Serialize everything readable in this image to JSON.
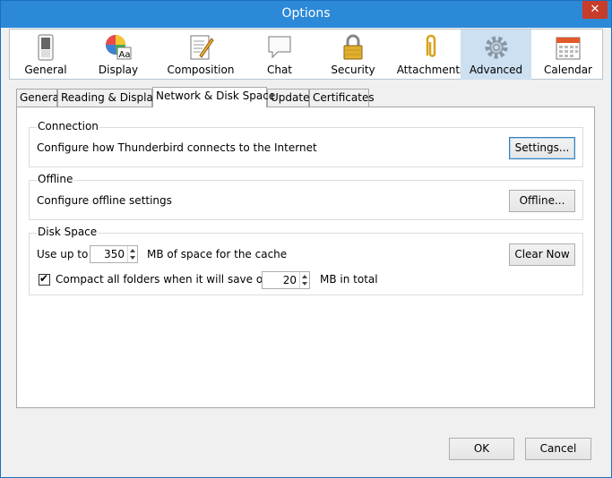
{
  "window": {
    "title": "Options",
    "close": "✕"
  },
  "categories": [
    {
      "label": "General"
    },
    {
      "label": "Display"
    },
    {
      "label": "Composition"
    },
    {
      "label": "Chat"
    },
    {
      "label": "Security"
    },
    {
      "label": "Attachments"
    },
    {
      "label": "Advanced",
      "selected": true
    },
    {
      "label": "Calendar"
    }
  ],
  "subtabs": [
    {
      "label": "General"
    },
    {
      "label": "Reading & Display"
    },
    {
      "label": "Network & Disk Space",
      "selected": true
    },
    {
      "label": "Update"
    },
    {
      "label": "Certificates"
    }
  ],
  "connection": {
    "title": "Connection",
    "description": "Configure how Thunderbird connects to the Internet",
    "button": "Settings..."
  },
  "offline": {
    "title": "Offline",
    "description": "Configure offline settings",
    "button": "Offline..."
  },
  "disk": {
    "title": "Disk Space",
    "use_up_to": "Use up to",
    "cache_value": "350",
    "cache_suffix": "MB of space for the cache",
    "clear_button": "Clear Now",
    "compact_label": "Compact all folders when it will save over",
    "compact_checked": true,
    "compact_value": "20",
    "compact_suffix": "MB in total"
  },
  "footer": {
    "ok": "OK",
    "cancel": "Cancel"
  },
  "colors": {
    "titlebar": "#2c89d8",
    "close": "#c83c2a",
    "selected_cat": "#cde0f1"
  }
}
